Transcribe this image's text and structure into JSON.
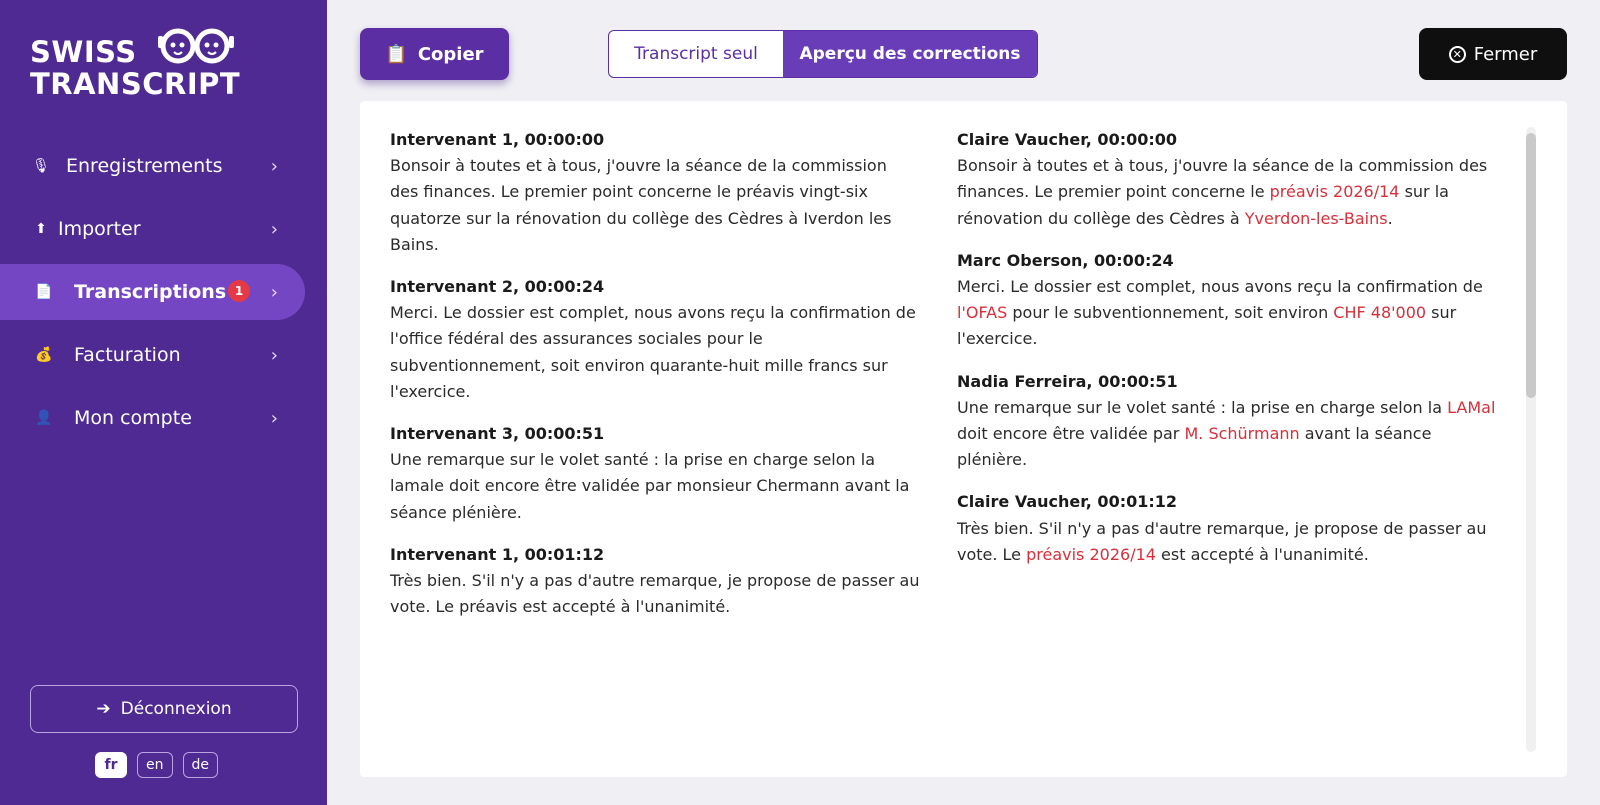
{
  "brand": {
    "line1": "SWISS",
    "line2": "TRANSCRIPT"
  },
  "sidebar": {
    "items": [
      {
        "label": "Enregistrements",
        "icon": "microphone-icon",
        "glyph": "🎙",
        "chevron": "›"
      },
      {
        "label": "Importer",
        "icon": "upload-arrow-icon",
        "glyph": "⬆",
        "chevron": "›"
      },
      {
        "label": "Transcriptions",
        "icon": "document-icon",
        "glyph": "📄",
        "chevron": "›",
        "badge": "1",
        "active": true
      },
      {
        "label": "Facturation",
        "icon": "money-bag-icon",
        "glyph": "💰",
        "chevron": "›"
      },
      {
        "label": "Mon compte",
        "icon": "user-icon",
        "glyph": "👤",
        "chevron": "›"
      }
    ],
    "logout": {
      "label": "Déconnexion",
      "glyph": "➔"
    },
    "languages": [
      {
        "code": "fr",
        "active": true
      },
      {
        "code": "en"
      },
      {
        "code": "de"
      }
    ]
  },
  "toolbar": {
    "copy_label": "Copier",
    "copy_glyph": "📋",
    "toggle": {
      "option1": "Transcript seul",
      "option2": "Aperçu des corrections"
    },
    "close_label": "Fermer",
    "close_glyph": "✕"
  },
  "colors": {
    "sidebar": "#4f2a92",
    "accent": "#6a3db8",
    "correction": "#d6303a",
    "badge": "#e53945"
  },
  "transcript_raw": [
    {
      "head": "Intervenant 1, 00:00:00",
      "text": "Bonsoir à toutes et à tous, j'ouvre la séance de la commission des finances. Le premier point concerne le préavis vingt-six quatorze sur la rénovation du collège des Cèdres à Iverdon les Bains."
    },
    {
      "head": "Intervenant 2, 00:00:24",
      "text": "Merci. Le dossier est complet, nous avons reçu la confirmation de l'office fédéral des assurances sociales pour le subventionnement, soit environ quarante-huit mille francs sur l'exercice."
    },
    {
      "head": "Intervenant 3, 00:00:51",
      "text": "Une remarque sur le volet santé : la prise en charge selon la lamale doit encore être validée par monsieur Chermann avant la séance plénière."
    },
    {
      "head": "Intervenant 1, 00:01:12",
      "text": "Très bien. S'il n'y a pas d'autre remarque, je propose de passer au vote. Le préavis est accepté à l'unanimité."
    }
  ],
  "transcript_corrected": [
    {
      "head": "Claire Vaucher, 00:00:00",
      "parts": [
        {
          "t": "Bonsoir à toutes et à tous, j'ouvre la séance de la commission des finances. Le premier point concerne le "
        },
        {
          "t": "préavis 2026/14",
          "c": true
        },
        {
          "t": " sur la rénovation du collège des Cèdres à "
        },
        {
          "t": "Yverdon-les-Bains",
          "c": true
        },
        {
          "t": "."
        }
      ]
    },
    {
      "head": "Marc Oberson, 00:00:24",
      "parts": [
        {
          "t": "Merci. Le dossier est complet, nous avons reçu la confirmation de "
        },
        {
          "t": "l'OFAS",
          "c": true
        },
        {
          "t": " pour le subventionnement, soit environ "
        },
        {
          "t": "CHF 48'000",
          "c": true
        },
        {
          "t": " sur l'exercice."
        }
      ]
    },
    {
      "head": "Nadia Ferreira, 00:00:51",
      "parts": [
        {
          "t": "Une remarque sur le volet santé : la prise en charge selon la "
        },
        {
          "t": "LAMal",
          "c": true
        },
        {
          "t": " doit encore être validée par "
        },
        {
          "t": "M. Schürmann",
          "c": true
        },
        {
          "t": " avant la séance plénière."
        }
      ]
    },
    {
      "head": "Claire Vaucher, 00:01:12",
      "parts": [
        {
          "t": "Très bien. S'il n'y a pas d'autre remarque, je propose de passer au vote. Le "
        },
        {
          "t": "préavis 2026/14",
          "c": true
        },
        {
          "t": " est accepté à l'unanimité."
        }
      ]
    }
  ]
}
